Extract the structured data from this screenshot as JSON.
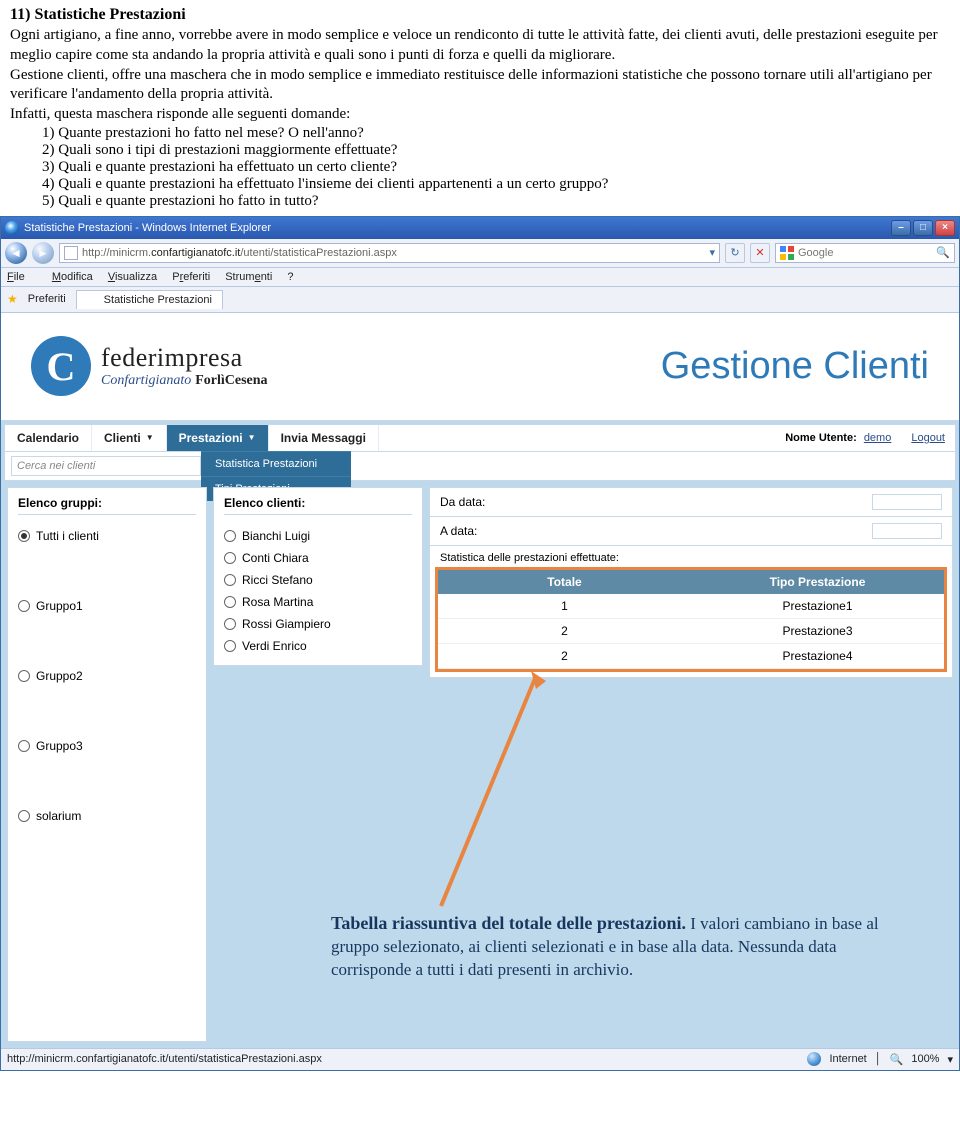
{
  "doc": {
    "heading": "11) Statistiche Prestazioni",
    "para1": "Ogni artigiano, a fine anno, vorrebbe avere in modo semplice e veloce un rendiconto di tutte le attività fatte, dei clienti avuti, delle prestazioni eseguite per meglio capire come sta andando la propria attività e quali sono i punti di forza e quelli da migliorare.",
    "para2": "Gestione clienti, offre una maschera che in modo semplice e immediato restituisce delle informazioni statistiche che possono tornare utili all'artigiano per verificare l'andamento della propria attività.",
    "para3": "Infatti, questa maschera risponde alle seguenti domande:",
    "questions": [
      "1)  Quante prestazioni ho fatto nel mese? O nell'anno?",
      "2)  Quali sono i tipi di prestazioni maggiormente effettuate?",
      "3)  Quali e quante prestazioni ha effettuato un certo cliente?",
      "4)  Quali e quante prestazioni ha effettuato l'insieme dei clienti appartenenti a un certo gruppo?",
      "5)  Quali e quante prestazioni ho fatto in tutto?"
    ]
  },
  "ie": {
    "title": "Statistiche Prestazioni - Windows Internet Explorer",
    "url_prefix": "http://minicrm.",
    "url_bold": "confartigianatofc.it",
    "url_suffix": "/utenti/statisticaPrestazioni.aspx",
    "search_placeholder": "Google",
    "menu": {
      "file": "File",
      "modifica": "Modifica",
      "visualizza": "Visualizza",
      "preferiti": "Preferiti",
      "strumenti": "Strumenti",
      "help": "?"
    },
    "fav_label": "Preferiti",
    "tab_label": "Statistiche Prestazioni",
    "status_url": "http://minicrm.confartigianatofc.it/utenti/statisticaPrestazioni.aspx",
    "status_zone": "Internet",
    "status_zoom": "100%"
  },
  "page": {
    "logo_top": "federimpresa",
    "logo_sub_italic": "Confartigianato",
    "logo_sub_city": "ForlìCesena",
    "banner_right": "Gestione Clienti",
    "nav": {
      "calendario": "Calendario",
      "clienti": "Clienti",
      "prestazioni": "Prestazioni",
      "invia": "Invia Messaggi",
      "nome_utente_lbl": "Nome Utente:",
      "nome_utente_val": "demo",
      "logout": "Logout"
    },
    "dropdown": {
      "item1": "Statistica Prestazioni",
      "item2": "Tipi Prestazioni"
    },
    "search_placeholder": "Cerca nei clienti",
    "groups": {
      "title": "Elenco gruppi:",
      "items": [
        "Tutti i clienti",
        "Gruppo1",
        "Gruppo2",
        "Gruppo3",
        "solarium"
      ]
    },
    "clients": {
      "title": "Elenco clienti:",
      "items": [
        "Bianchi Luigi",
        "Conti Chiara",
        "Ricci Stefano",
        "Rosa Martina",
        "Rossi Giampiero",
        "Verdi Enrico"
      ]
    },
    "right": {
      "da_data": "Da data:",
      "a_data": "A data:",
      "stat_title": "Statistica delle prestazioni effettuate:",
      "col_totale": "Totale",
      "col_tipo": "Tipo Prestazione",
      "rows": [
        {
          "tot": "1",
          "tipo": "Prestazione1"
        },
        {
          "tot": "2",
          "tipo": "Prestazione3"
        },
        {
          "tot": "2",
          "tipo": "Prestazione4"
        }
      ]
    },
    "callout": {
      "title": "Tabella riassuntiva del totale delle prestazioni.",
      "body": "I valori cambiano in base al gruppo selezionato, ai clienti selezionati e in base alla data. Nessunda data corrisponde a tutti i dati presenti in archivio."
    }
  }
}
